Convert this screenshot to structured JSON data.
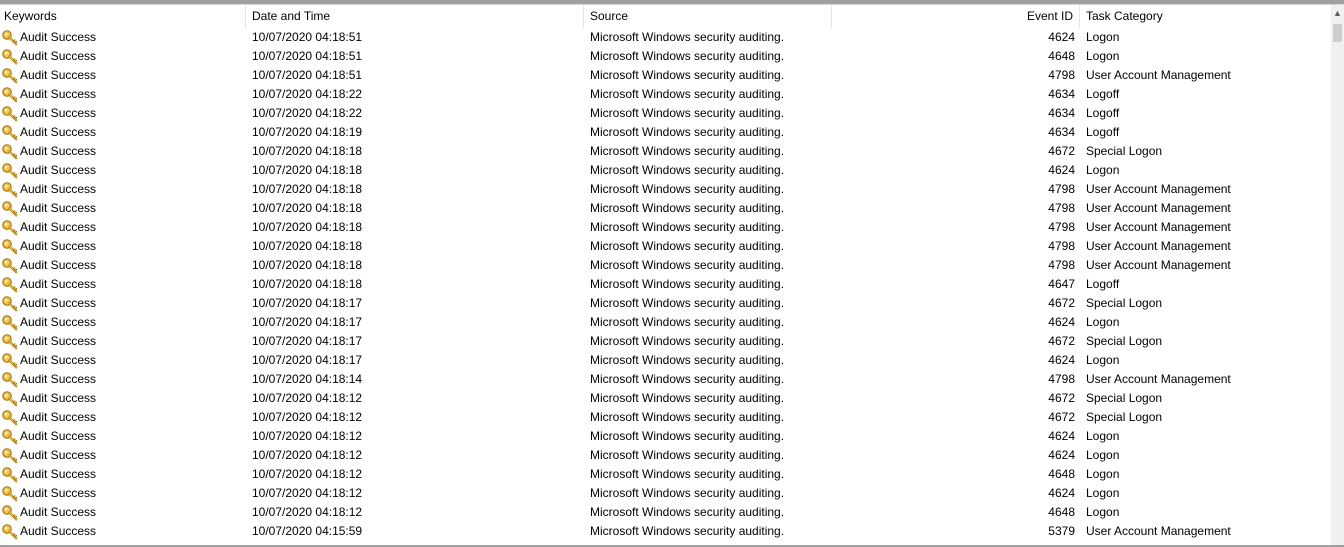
{
  "columns": {
    "keywords": "Keywords",
    "date_time": "Date and Time",
    "source": "Source",
    "event_id": "Event ID",
    "task_category": "Task Category"
  },
  "scrollbar": {
    "up_arrow": "▲"
  },
  "icon": "key-icon",
  "rows": [
    {
      "keyword": "Audit Success",
      "datetime": "10/07/2020 04:18:51",
      "source": "Microsoft Windows security auditing.",
      "event_id": "4624",
      "category": "Logon"
    },
    {
      "keyword": "Audit Success",
      "datetime": "10/07/2020 04:18:51",
      "source": "Microsoft Windows security auditing.",
      "event_id": "4648",
      "category": "Logon"
    },
    {
      "keyword": "Audit Success",
      "datetime": "10/07/2020 04:18:51",
      "source": "Microsoft Windows security auditing.",
      "event_id": "4798",
      "category": "User Account Management"
    },
    {
      "keyword": "Audit Success",
      "datetime": "10/07/2020 04:18:22",
      "source": "Microsoft Windows security auditing.",
      "event_id": "4634",
      "category": "Logoff"
    },
    {
      "keyword": "Audit Success",
      "datetime": "10/07/2020 04:18:22",
      "source": "Microsoft Windows security auditing.",
      "event_id": "4634",
      "category": "Logoff"
    },
    {
      "keyword": "Audit Success",
      "datetime": "10/07/2020 04:18:19",
      "source": "Microsoft Windows security auditing.",
      "event_id": "4634",
      "category": "Logoff"
    },
    {
      "keyword": "Audit Success",
      "datetime": "10/07/2020 04:18:18",
      "source": "Microsoft Windows security auditing.",
      "event_id": "4672",
      "category": "Special Logon"
    },
    {
      "keyword": "Audit Success",
      "datetime": "10/07/2020 04:18:18",
      "source": "Microsoft Windows security auditing.",
      "event_id": "4624",
      "category": "Logon"
    },
    {
      "keyword": "Audit Success",
      "datetime": "10/07/2020 04:18:18",
      "source": "Microsoft Windows security auditing.",
      "event_id": "4798",
      "category": "User Account Management"
    },
    {
      "keyword": "Audit Success",
      "datetime": "10/07/2020 04:18:18",
      "source": "Microsoft Windows security auditing.",
      "event_id": "4798",
      "category": "User Account Management"
    },
    {
      "keyword": "Audit Success",
      "datetime": "10/07/2020 04:18:18",
      "source": "Microsoft Windows security auditing.",
      "event_id": "4798",
      "category": "User Account Management"
    },
    {
      "keyword": "Audit Success",
      "datetime": "10/07/2020 04:18:18",
      "source": "Microsoft Windows security auditing.",
      "event_id": "4798",
      "category": "User Account Management"
    },
    {
      "keyword": "Audit Success",
      "datetime": "10/07/2020 04:18:18",
      "source": "Microsoft Windows security auditing.",
      "event_id": "4798",
      "category": "User Account Management"
    },
    {
      "keyword": "Audit Success",
      "datetime": "10/07/2020 04:18:18",
      "source": "Microsoft Windows security auditing.",
      "event_id": "4647",
      "category": "Logoff"
    },
    {
      "keyword": "Audit Success",
      "datetime": "10/07/2020 04:18:17",
      "source": "Microsoft Windows security auditing.",
      "event_id": "4672",
      "category": "Special Logon"
    },
    {
      "keyword": "Audit Success",
      "datetime": "10/07/2020 04:18:17",
      "source": "Microsoft Windows security auditing.",
      "event_id": "4624",
      "category": "Logon"
    },
    {
      "keyword": "Audit Success",
      "datetime": "10/07/2020 04:18:17",
      "source": "Microsoft Windows security auditing.",
      "event_id": "4672",
      "category": "Special Logon"
    },
    {
      "keyword": "Audit Success",
      "datetime": "10/07/2020 04:18:17",
      "source": "Microsoft Windows security auditing.",
      "event_id": "4624",
      "category": "Logon"
    },
    {
      "keyword": "Audit Success",
      "datetime": "10/07/2020 04:18:14",
      "source": "Microsoft Windows security auditing.",
      "event_id": "4798",
      "category": "User Account Management"
    },
    {
      "keyword": "Audit Success",
      "datetime": "10/07/2020 04:18:12",
      "source": "Microsoft Windows security auditing.",
      "event_id": "4672",
      "category": "Special Logon"
    },
    {
      "keyword": "Audit Success",
      "datetime": "10/07/2020 04:18:12",
      "source": "Microsoft Windows security auditing.",
      "event_id": "4672",
      "category": "Special Logon"
    },
    {
      "keyword": "Audit Success",
      "datetime": "10/07/2020 04:18:12",
      "source": "Microsoft Windows security auditing.",
      "event_id": "4624",
      "category": "Logon"
    },
    {
      "keyword": "Audit Success",
      "datetime": "10/07/2020 04:18:12",
      "source": "Microsoft Windows security auditing.",
      "event_id": "4624",
      "category": "Logon"
    },
    {
      "keyword": "Audit Success",
      "datetime": "10/07/2020 04:18:12",
      "source": "Microsoft Windows security auditing.",
      "event_id": "4648",
      "category": "Logon"
    },
    {
      "keyword": "Audit Success",
      "datetime": "10/07/2020 04:18:12",
      "source": "Microsoft Windows security auditing.",
      "event_id": "4624",
      "category": "Logon"
    },
    {
      "keyword": "Audit Success",
      "datetime": "10/07/2020 04:18:12",
      "source": "Microsoft Windows security auditing.",
      "event_id": "4648",
      "category": "Logon"
    },
    {
      "keyword": "Audit Success",
      "datetime": "10/07/2020 04:15:59",
      "source": "Microsoft Windows security auditing.",
      "event_id": "5379",
      "category": "User Account Management"
    }
  ]
}
